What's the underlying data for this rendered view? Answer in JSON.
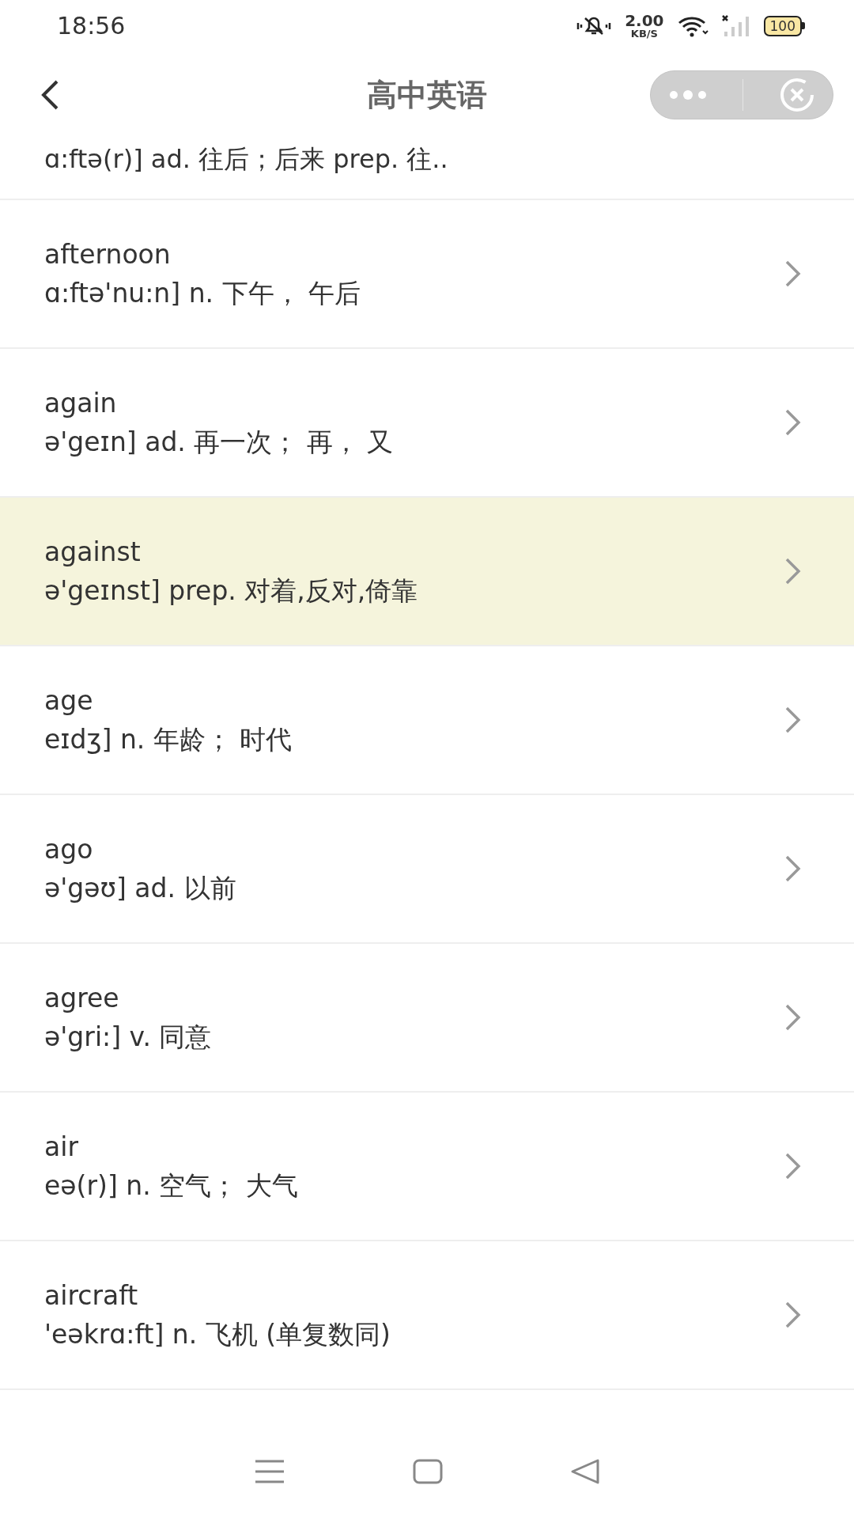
{
  "status_bar": {
    "time": "18:56",
    "net_speed": "2.00",
    "net_unit": "KB/S",
    "battery": "100"
  },
  "header": {
    "title": "高中英语"
  },
  "partial_row": {
    "definition": "ɑ:ftə(r)] ad. 往后；后来 prep. 往.."
  },
  "words": [
    {
      "word": "afternoon",
      "definition": "ɑ:ftə'nu:n] n. 下午， 午后",
      "selected": false
    },
    {
      "word": "again",
      "definition": "ə'geɪn] ad. 再一次； 再， 又",
      "selected": false
    },
    {
      "word": "against",
      "definition": "ə'geɪnst] prep. 对着,反对,倚靠",
      "selected": true
    },
    {
      "word": "age",
      "definition": "eɪdʒ] n. 年龄； 时代",
      "selected": false
    },
    {
      "word": "ago",
      "definition": "ə'gəʊ] ad. 以前",
      "selected": false
    },
    {
      "word": "agree",
      "definition": "ə'gri:] v. 同意",
      "selected": false
    },
    {
      "word": "air",
      "definition": "eə(r)] n. 空气； 大气",
      "selected": false
    },
    {
      "word": "aircraft",
      "definition": "'eəkrɑ:ft] n. 飞机 (单复数同)",
      "selected": false
    }
  ]
}
